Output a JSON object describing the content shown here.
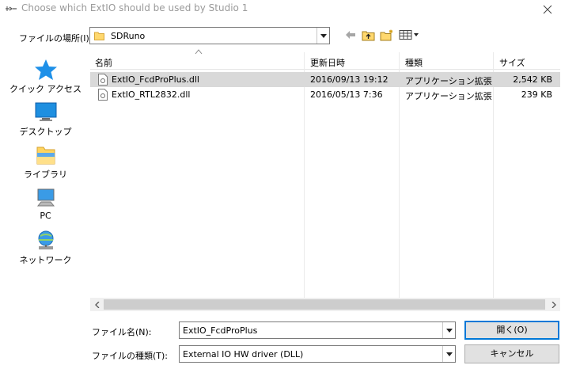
{
  "window": {
    "title": "Choose which ExtIO should be used by Studio 1"
  },
  "toolbar": {
    "look_in_label": "ファイルの場所(I):",
    "look_in_value": "SDRuno"
  },
  "places": [
    {
      "label": "クイック アクセス",
      "icon": "star-icon"
    },
    {
      "label": "デスクトップ",
      "icon": "desktop-icon"
    },
    {
      "label": "ライブラリ",
      "icon": "library-icon"
    },
    {
      "label": "PC",
      "icon": "computer-icon"
    },
    {
      "label": "ネットワーク",
      "icon": "network-icon"
    }
  ],
  "columns": {
    "name": "名前",
    "date": "更新日時",
    "type": "種類",
    "size": "サイズ"
  },
  "files": [
    {
      "name": "ExtIO_FcdProPlus.dll",
      "date": "2016/09/13 19:12",
      "type": "アプリケーション拡張",
      "size": "2,542 KB",
      "selected": true
    },
    {
      "name": "ExtIO_RTL2832.dll",
      "date": "2016/05/13 7:36",
      "type": "アプリケーション拡張",
      "size": "239 KB",
      "selected": false
    }
  ],
  "footer": {
    "filename_label": "ファイル名(N):",
    "filename_value": "ExtIO_FcdProPlus",
    "filetype_label": "ファイルの種類(T):",
    "filetype_value": "External IO HW driver (DLL)",
    "open_button": "開く(O)",
    "cancel_button": "キャンセル"
  },
  "colors": {
    "selection": "#d9d9d9",
    "title_text": "#9a9a9a",
    "default_button_border": "#0078d7"
  }
}
